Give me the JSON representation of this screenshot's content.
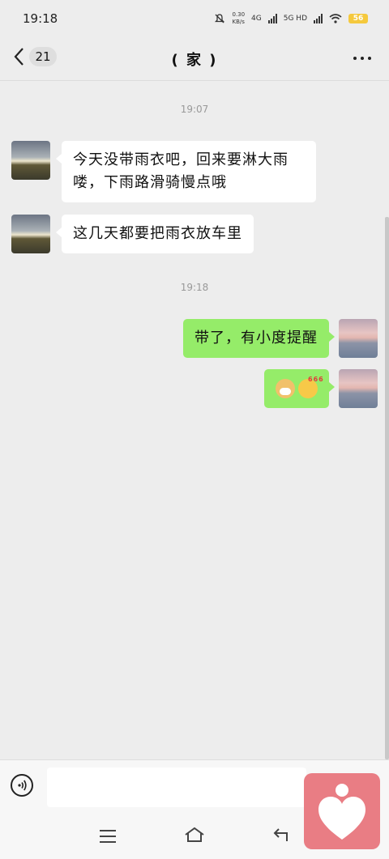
{
  "status_bar": {
    "time": "19:18",
    "net_speed_value": "0.30",
    "net_speed_unit": "KB/s",
    "sim1": "4G",
    "sim2": "5G HD",
    "battery": "56"
  },
  "header": {
    "back_count": "21",
    "title": "( 家 )"
  },
  "messages": [
    {
      "type": "time",
      "text": "19:07"
    },
    {
      "type": "incoming",
      "text": "今天没带雨衣吧，回来要淋大雨喽，下雨路滑骑慢点哦"
    },
    {
      "type": "incoming",
      "text": "这几天都要把雨衣放车里"
    },
    {
      "type": "time",
      "text": "19:18"
    },
    {
      "type": "outgoing",
      "text": "带了，有小度提醒"
    },
    {
      "type": "outgoing",
      "emojis": [
        "doge-emoji",
        "666-emoji"
      ],
      "emoji_caption": "666"
    }
  ],
  "input": {
    "placeholder": ""
  },
  "icons": {
    "back": "chevron-left-icon",
    "more": "more-dots-icon",
    "voice": "voice-icon",
    "menu": "menu-icon",
    "home": "home-icon",
    "return": "back-nav-icon",
    "widget": "heart-person-icon"
  },
  "colors": {
    "background": "#ededed",
    "outgoing_bubble": "#95ec69",
    "incoming_bubble": "#ffffff",
    "widget": "#e97d84",
    "battery": "#f5c93d"
  }
}
